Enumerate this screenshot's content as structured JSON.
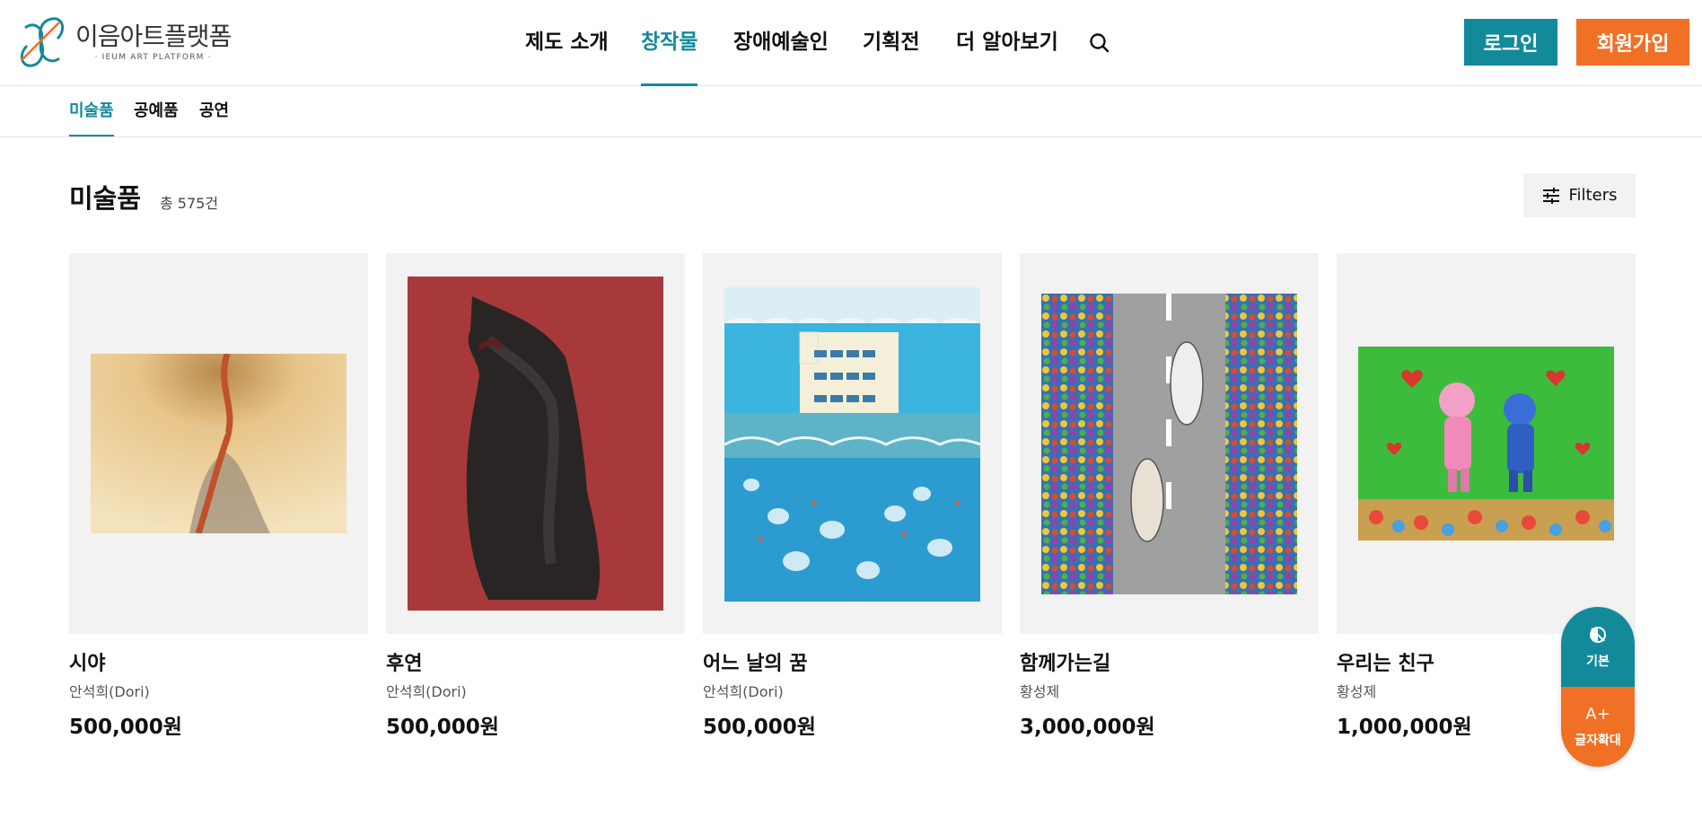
{
  "logo": {
    "name_ko": "이음아트플랫폼",
    "name_en": "· IEUM ART PLATFORM ·"
  },
  "nav": {
    "items": [
      {
        "label": "제도 소개"
      },
      {
        "label": "창작물"
      },
      {
        "label": "장애예술인"
      },
      {
        "label": "기획전"
      },
      {
        "label": "더 알아보기"
      }
    ],
    "active": "창작물",
    "search_icon": "search-icon"
  },
  "auth": {
    "login": "로그인",
    "join": "회원가입"
  },
  "colors": {
    "accent": "#138a9a",
    "brand_orange": "#f07025"
  },
  "subnav": {
    "items": [
      "미술품",
      "공예품",
      "공연"
    ],
    "active": "미술품"
  },
  "section": {
    "title": "미술품",
    "total": "총 575건",
    "filters_label": "Filters"
  },
  "artworks": [
    {
      "title": "시야",
      "artist": "안석희(Dori)",
      "price": "500,000원"
    },
    {
      "title": "후연",
      "artist": "안석희(Dori)",
      "price": "500,000원"
    },
    {
      "title": "어느 날의 꿈",
      "artist": "안석희(Dori)",
      "price": "500,000원"
    },
    {
      "title": "함께가는길",
      "artist": "황성제",
      "price": "3,000,000원"
    },
    {
      "title": "우리는 친구",
      "artist": "황성제",
      "price": "1,000,000원"
    }
  ],
  "a11y": {
    "default_label": "기본",
    "zoom_glyph": "A+",
    "zoom_label": "글자확대"
  }
}
